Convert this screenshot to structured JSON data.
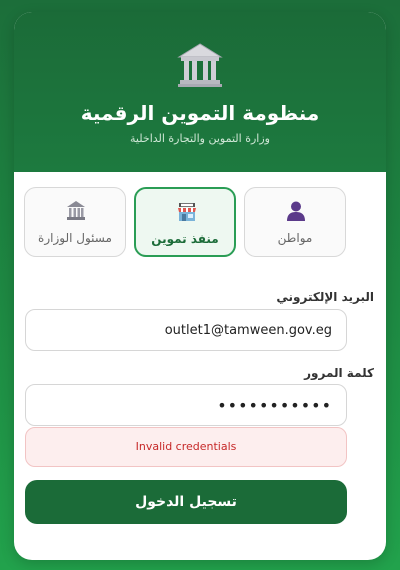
{
  "header": {
    "logo_icon": "government-building-icon",
    "title": "منظومة التموين الرقمية",
    "subtitle": "وزارة التموين والتجارة الداخلية"
  },
  "roles": [
    {
      "label": "مسئول الوزارة",
      "icon": "ministry-building-icon",
      "selected": false
    },
    {
      "label": "منفذ تموين",
      "icon": "store-icon",
      "selected": true
    },
    {
      "label": "مواطن",
      "icon": "person-icon",
      "selected": false
    }
  ],
  "form": {
    "email_label": "البريد الإلكتروني",
    "email_value": "outlet1@tamween.gov.eg",
    "password_label": "كلمة المرور",
    "password_value": "•••••••••••",
    "error_message": "Invalid credentials",
    "submit_label": "تسجيل الدخول"
  },
  "colors": {
    "brand_green": "#1b6b38",
    "accent_green": "#2a9d55",
    "error_red": "#c62828"
  }
}
